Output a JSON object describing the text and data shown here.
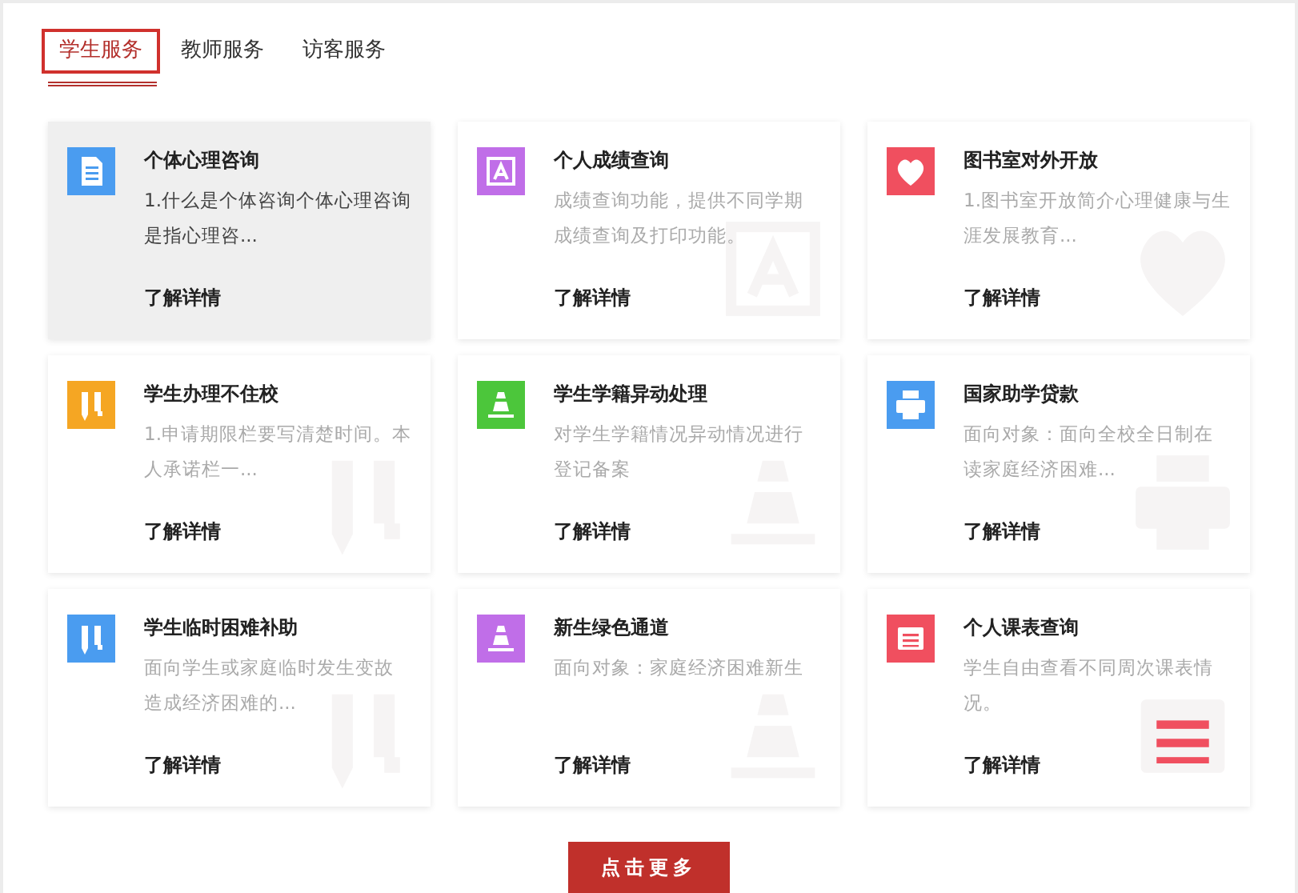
{
  "tabs": [
    {
      "label": "学生服务",
      "selected": true
    },
    {
      "label": "教师服务",
      "selected": false
    },
    {
      "label": "访客服务",
      "selected": false
    }
  ],
  "cards": [
    {
      "title": "个体心理咨询",
      "description": "1.什么是个体咨询个体心理咨询是指心理咨...",
      "link": "了解详情",
      "kind": "document",
      "color": "#4a9cf0",
      "highlighted": true
    },
    {
      "title": "个人成绩查询",
      "description": "成绩查询功能，提供不同学期成绩查询及打印功能。",
      "link": "了解详情",
      "kind": "text",
      "color": "#c06ee8",
      "highlighted": false
    },
    {
      "title": "图书室对外开放",
      "description": "1.图书室开放简介心理健康与生涯发展教育...",
      "link": "了解详情",
      "kind": "heart",
      "color": "#f04f5f",
      "highlighted": false
    },
    {
      "title": "学生办理不住校",
      "description": "1.申请期限栏要写清楚时间。本人承诺栏一...",
      "link": "了解详情",
      "kind": "pens",
      "color": "#f5a623",
      "highlighted": false
    },
    {
      "title": "学生学籍异动处理",
      "description": "对学生学籍情况异动情况进行登记备案",
      "link": "了解详情",
      "kind": "cone",
      "color": "#4cc63b",
      "highlighted": false
    },
    {
      "title": "国家助学贷款",
      "description": "面向对象：面向全校全日制在读家庭经济困难...",
      "link": "了解详情",
      "kind": "printer",
      "color": "#4a9cf0",
      "highlighted": false
    },
    {
      "title": "学生临时困难补助",
      "description": "面向学生或家庭临时发生变故造成经济困难的...",
      "link": "了解详情",
      "kind": "pens",
      "color": "#4a9cf0",
      "highlighted": false
    },
    {
      "title": "新生绿色通道",
      "description": "面向对象：家庭经济困难新生",
      "link": "了解详情",
      "kind": "cone",
      "color": "#c06ee8",
      "highlighted": false
    },
    {
      "title": "个人课表查询",
      "description": "学生自由查看不同周次课表情况。",
      "link": "了解详情",
      "kind": "list",
      "color": "#f04f5f",
      "highlighted": false
    }
  ],
  "more_button": "点击更多"
}
